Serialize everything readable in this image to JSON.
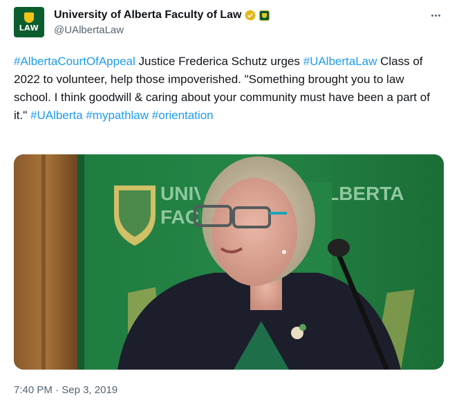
{
  "tweet": {
    "author": {
      "display_name": "University of Alberta Faculty of Law",
      "handle": "@UAlbertaLaw",
      "avatar_text": "LAW",
      "verified_badge": "gold-checkmark-icon",
      "affiliate_badge": "university-of-alberta-crest-icon"
    },
    "more_icon": "more-horizontal-icon",
    "body": {
      "hashtag_1": "#AlbertaCourtOfAppeal",
      "text_1": " Justice Frederica Schutz urges ",
      "hashtag_2": "#UAlbertaLaw",
      "text_2": " Class of 2022 to volunteer, help those impoverished.  \"Something brought you to law school. I think goodwill & caring about your community must have been a part of it.\" ",
      "hashtag_3": "#UAlberta",
      "hashtag_4": "#mypathlaw",
      "hashtag_5": "#orientation"
    },
    "photo": {
      "banner_line_1": "UNIVERSITY OF ALBERTA",
      "banner_line_2": "FACULTY OF LAW"
    },
    "time": "7:40 PM",
    "separator": " · ",
    "date": "Sep 3, 2019"
  },
  "colors": {
    "link": "#1d9bf0",
    "text": "#0f1419",
    "secondary": "#536471",
    "ualberta_green": "#0b5d2e",
    "ualberta_gold": "#f2c418"
  }
}
